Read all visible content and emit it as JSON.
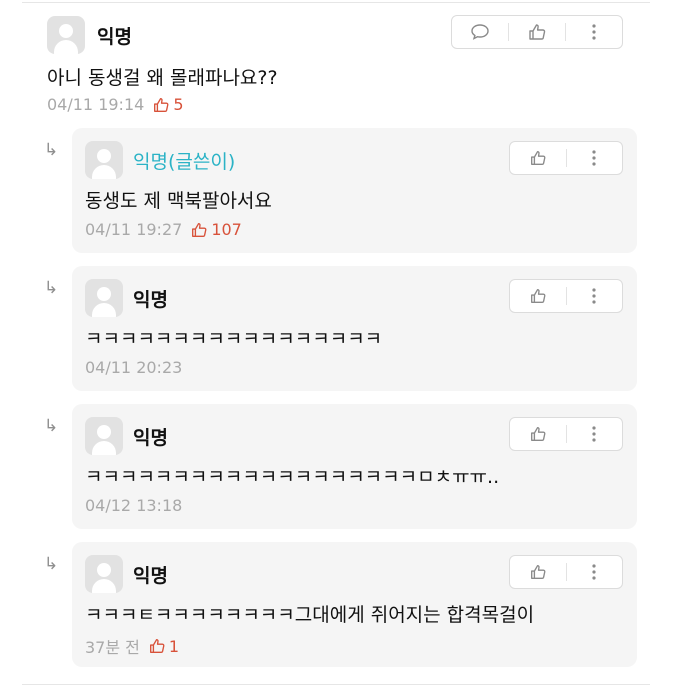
{
  "main_comment": {
    "author": "익명",
    "text": "아니 동생걸 왜 몰래파나요??",
    "time": "04/11 19:14",
    "likes": "5",
    "actions": [
      "comment-icon",
      "thumbs-up-icon",
      "more-vertical-icon"
    ]
  },
  "replies": [
    {
      "author": "익명(글쓴이)",
      "is_op": true,
      "text": "동생도 제 맥북팔아서요",
      "time": "04/11 19:27",
      "likes": "107"
    },
    {
      "author": "익명",
      "is_op": false,
      "text": "ㅋㅋㅋㅋㅋㅋㅋㅋㅋㅋㅋㅋㅋㅋㅋㅋㅋ",
      "time": "04/11 20:23",
      "likes": ""
    },
    {
      "author": "익명",
      "is_op": false,
      "text": "ㅋㅋㅋㅋㅋㅋㅋㅋㅋㅋㅋㅋㅋㅋㅋㅋㅋㅋㅋㅁㅊㅠㅠ..",
      "time": "04/12 13:18",
      "likes": ""
    },
    {
      "author": "익명",
      "is_op": false,
      "text": "ㅋㅋㅋㅌㅋㅋㅋㅋㅋㅋㅋㅋ그대에게 쥐어지는 합격목걸이",
      "time": "37분 전",
      "likes": "1"
    }
  ],
  "reply_arrow": "↳",
  "colors": {
    "op_name": "#2bb3c6",
    "like": "#d8523a",
    "meta": "#a9a9a9",
    "reply_bg": "#f5f5f5"
  }
}
